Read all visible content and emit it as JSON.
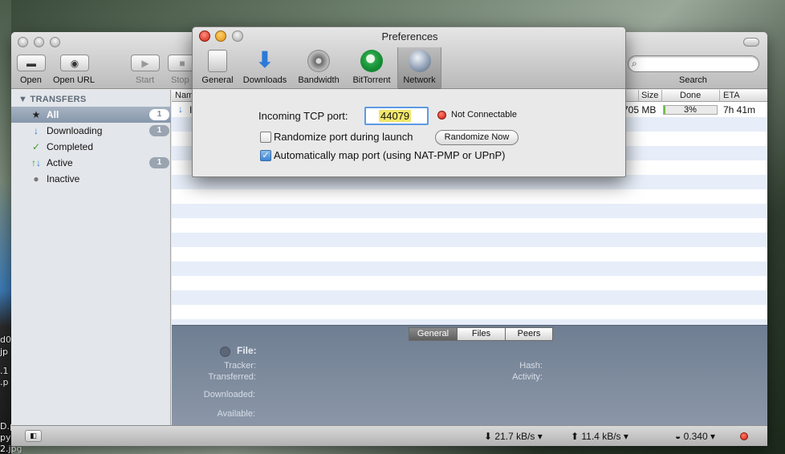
{
  "desktop": {
    "labels": [
      "d0",
      "jp",
      ".1",
      ".p",
      "D.p",
      "py",
      "2.jpg"
    ]
  },
  "toolbar": {
    "open_label": "Open",
    "open_url_label": "Open URL",
    "start_label": "Start",
    "stop_label": "Stop",
    "search_label": "Search",
    "search_value": ""
  },
  "sidebar": {
    "header": "TRANSFERS",
    "items": [
      {
        "label": "All",
        "count": "1",
        "icon": "star-icon"
      },
      {
        "label": "Downloading",
        "count": "1",
        "icon": "arrow-down-icon"
      },
      {
        "label": "Completed",
        "count": "",
        "icon": "checkmark-icon"
      },
      {
        "label": "Active",
        "count": "1",
        "icon": "up-down-arrows-icon"
      },
      {
        "label": "Inactive",
        "count": "",
        "icon": "gray-dot-icon"
      }
    ]
  },
  "list": {
    "columns": {
      "name": "Nam",
      "size": "Size",
      "done": "Done",
      "eta": "ETA"
    },
    "rows": [
      {
        "name": "I",
        "size": "705 MB",
        "done_label": "3%",
        "done_fraction": 0.03,
        "eta": "7h 41m"
      }
    ]
  },
  "inspector": {
    "tabs": [
      "General",
      "Files",
      "Peers"
    ],
    "active_tab": "General",
    "file_label": "File:",
    "tracker_label": "Tracker:",
    "transferred_label": "Transferred:",
    "downloaded_label": "Downloaded:",
    "available_label": "Available:",
    "hash_label": "Hash:",
    "activity_label": "Activity:"
  },
  "statusbar": {
    "download_rate": "21.7 kB/s",
    "upload_rate": "11.4 kB/s",
    "ratio": "0.340"
  },
  "preferences": {
    "title": "Preferences",
    "tabs": [
      {
        "label": "General",
        "icon": "switch-icon"
      },
      {
        "label": "Downloads",
        "icon": "download-arrow-icon"
      },
      {
        "label": "Bandwidth",
        "icon": "gauge-icon"
      },
      {
        "label": "BitTorrent",
        "icon": "bittorrent-icon"
      },
      {
        "label": "Network",
        "icon": "globe-icon"
      }
    ],
    "selected_tab": "Network",
    "tcp_port_label": "Incoming TCP port:",
    "tcp_port_value": "44079",
    "status": "Not Connectable",
    "randomize_label": "Randomize port during launch",
    "randomize_checked": false,
    "randomize_button": "Randomize Now",
    "automap_label": "Automatically map port (using NAT-PMP or UPnP)",
    "automap_checked": true
  },
  "colors": {
    "accent": "#5c9ae5",
    "status_red": "#d11a0a",
    "progress_green": "#6cbf4a",
    "port_highlight": "#f1e66a"
  }
}
